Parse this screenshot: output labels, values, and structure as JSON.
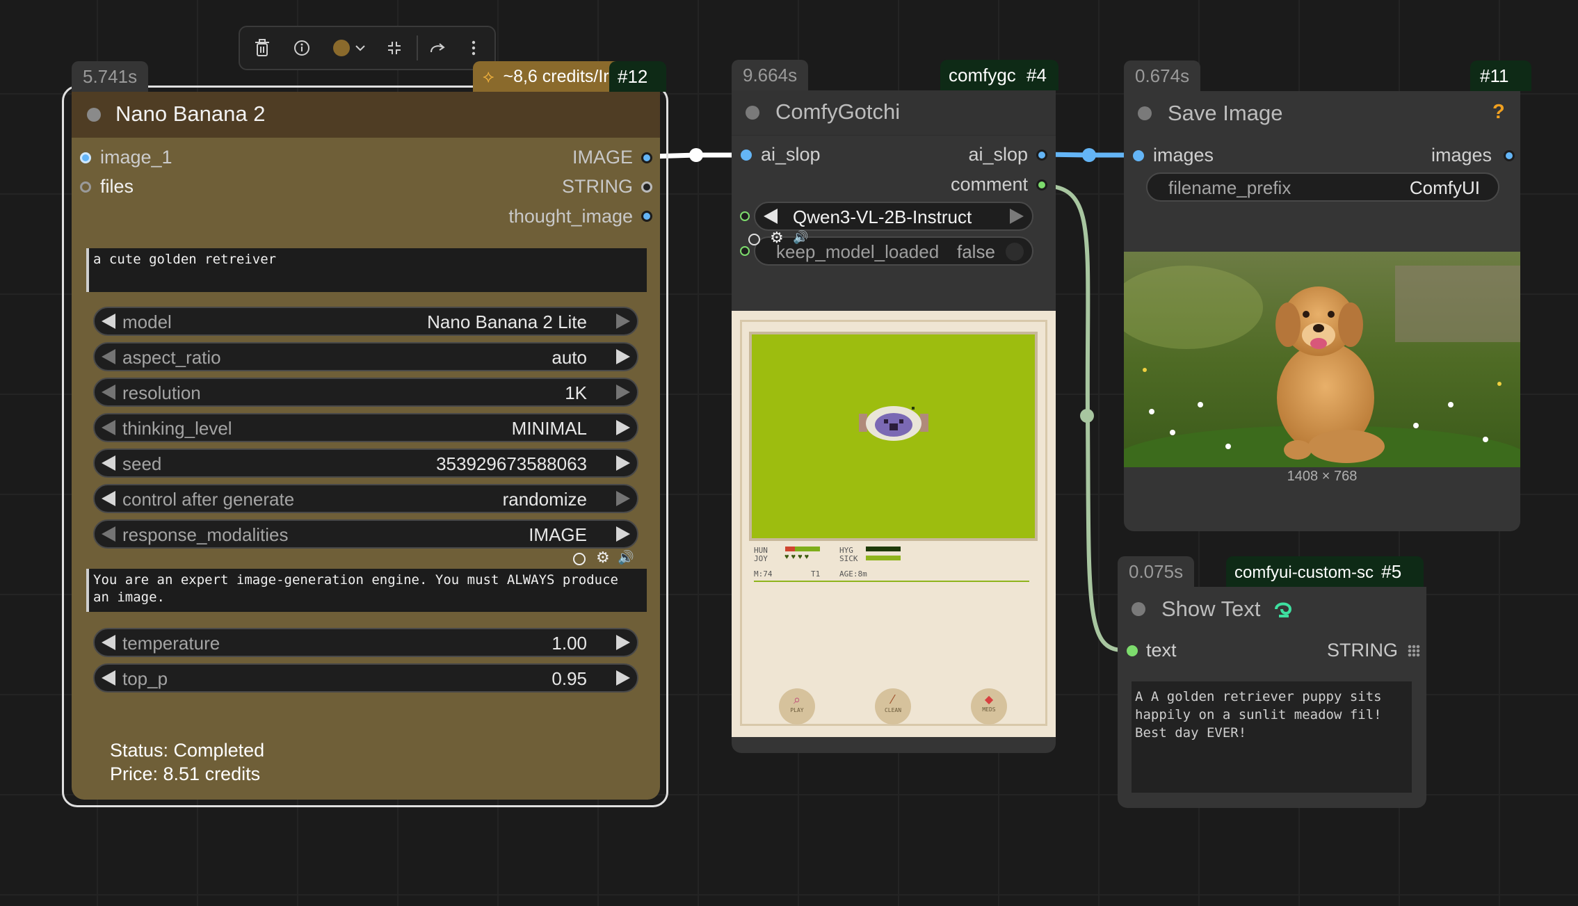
{
  "toolbar": {
    "delete_icon": "trash-icon",
    "info_icon": "info-icon",
    "color_icon": "color-dot-icon",
    "collapse_icon": "collapse-icon",
    "bypass_icon": "redo-icon",
    "more_icon": "more-vertical-icon",
    "color": "#8a6a2c"
  },
  "node12": {
    "time": "5.741s",
    "credits": "~8,6 credits/Ir",
    "id": "#12",
    "title": "Nano Banana 2",
    "inputs": [
      "image_1",
      "files"
    ],
    "outputs": [
      "IMAGE",
      "STRING",
      "thought_image"
    ],
    "prompt": "a cute golden retreiver",
    "widgets": [
      {
        "name": "model",
        "value": "Nano Banana 2 Lite"
      },
      {
        "name": "aspect_ratio",
        "value": "auto"
      },
      {
        "name": "resolution",
        "value": "1K"
      },
      {
        "name": "thinking_level",
        "value": "MINIMAL"
      },
      {
        "name": "seed",
        "value": "353929673588063"
      },
      {
        "name": "control after generate",
        "value": "randomize"
      },
      {
        "name": "response_modalities",
        "value": "IMAGE"
      }
    ],
    "system_prompt_line1": "You are an expert image-generation engine. You must ALWAYS produce",
    "system_prompt_line2": "an image.",
    "widgets2": [
      {
        "name": "temperature",
        "value": "1.00"
      },
      {
        "name": "top_p",
        "value": "0.95"
      }
    ],
    "status": "Status: Completed",
    "price": "Price: 8.51 credits",
    "bg_color": "#6f5f38",
    "header_color": "#4f3d24"
  },
  "node4": {
    "time": "9.664s",
    "tag": "comfygc",
    "id": "#4",
    "title": "ComfyGotchi",
    "input": "ai_slop",
    "outputs": [
      "ai_slop",
      "comment"
    ],
    "model_value": "Qwen3-VL-2B-Instruct",
    "keep_label": "keep_model_loaded",
    "keep_value": "false",
    "stats": {
      "hun": "HUN",
      "joy": "JOY",
      "hyg": "HYG",
      "sick": "SICK",
      "money": "M:74",
      "tier": "T1",
      "age": "AGE:8m"
    },
    "buttons": [
      "PLAY",
      "CLEAN",
      "MEDS"
    ]
  },
  "node11": {
    "time": "0.674s",
    "id": "#11",
    "title": "Save Image",
    "help": "?",
    "input": "images",
    "output": "images",
    "filename_label": "filename_prefix",
    "filename_value": "ComfyUI",
    "image_size": "1408 × 768"
  },
  "node5": {
    "time": "0.075s",
    "tag": "comfyui-custom-sc",
    "id": "#5",
    "title": "Show Text",
    "input": "text",
    "output": "STRING",
    "text_line1": "A A golden retriever puppy sits",
    "text_line2": "happily on a sunlit meadow fil!",
    "text_line3": "Best day EVER!"
  },
  "colors": {
    "link_image": "#64b5f6",
    "link_string": "#a8c6a0",
    "accent_green": "#7ddc6d"
  }
}
